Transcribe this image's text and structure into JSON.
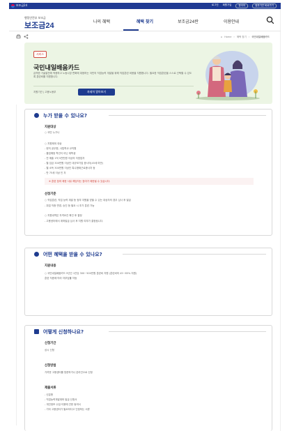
{
  "gov_banner": {
    "text": "대한민국 공식 전자정부 누리집",
    "brand": "보조금24",
    "links": [
      "로그인",
      "회원가입",
      "한국어",
      "정부기관 바로가기"
    ]
  },
  "header": {
    "logo_sub": "행정안전부 보조금",
    "logo": "보조금24",
    "nav": [
      "나의 혜택",
      "혜택 찾기",
      "보조금24란",
      "이용안내"
    ]
  },
  "breadcrumb": [
    "Home",
    "혜택 찾기",
    "국민내일배움카드"
  ],
  "hero": {
    "badge": "서비스",
    "title": "국민내일배움카드",
    "description": "급격한 기술발전에 적응하고 노동시장 변화에 대응하는 국민의 직업능력 개발을 위해 직업훈련 비용을 지원합니다. 필요한 직업훈련을 스스로 선택할 수 있도록 훈련비를 지원합니다.",
    "org": "지원기관 | 고용노동부",
    "button": "자세히 알아보기"
  },
  "sections": {
    "who": {
      "title": "누가 받을 수 있나요?",
      "sub1": "지원대상",
      "lines1": [
        "○ 국민 누구나",
        "○ 지원제외 대상",
        "  - 현직 공무원, 사립학교 교직원",
        "  - 졸업예정 학년이 아닌 재학생",
        "  - 연 매출 1억 5천만원 이상의 자영업자",
        "  - 월 임금 300만원 이상인 대규모기업 종사자(45세 미만)",
        "  - 월 소득 300만원 이상인 특수형태근로종사자 등",
        "  - 만 75세 이상 인 자"
      ],
      "warning": "※ 훈련 참여 제한 사유 해당자는 참여가 제한될 수 있습니다.",
      "sub2": "선정기준",
      "lines2": [
        "○ 직업훈련, 직업 능력 계발 등 정부 지원을 받을 수 있는 대상자의 경우 심사 후 발급",
        "  - 취업 직종 변경, 승진 등 필요 시 추가 훈련 가능",
        "○ 지원내역은 자격요건 확인 후 결정",
        "  - 고용센터에서 계좌발급 심사 후 지원 여부가 결정됩니다."
      ]
    },
    "what": {
      "title": "어떤 혜택을 받을 수 있나요?",
      "sub1": "지원내용",
      "lines1": [
        "○ 국민내일배움카드 5년간 1인당 300~500만원 훈련비 지원 (훈련비의 45~85% 지원)",
        "  훈련 직종에 따라 자부담률 차등"
      ]
    },
    "how": {
      "title": "어떻게 신청하나요?",
      "sub1": "신청기간",
      "line1": "상시 신청",
      "sub2": "신청방법",
      "line2": "가까운 고용센터를 방문하거나 온라인으로 신청",
      "sub3": "제출서류",
      "lines3": [
        "- 신분증",
        "- 직업능력개발계좌 발급 신청서",
        "- 개인정보 수집·이용에 관한 동의서",
        "- 기타 고용센터가 필요하다고 인정하는 서류"
      ]
    }
  },
  "colors": {
    "primary": "#1e3b8f",
    "hero_bg": "#ecf5e4",
    "warning": "#d1453b"
  }
}
